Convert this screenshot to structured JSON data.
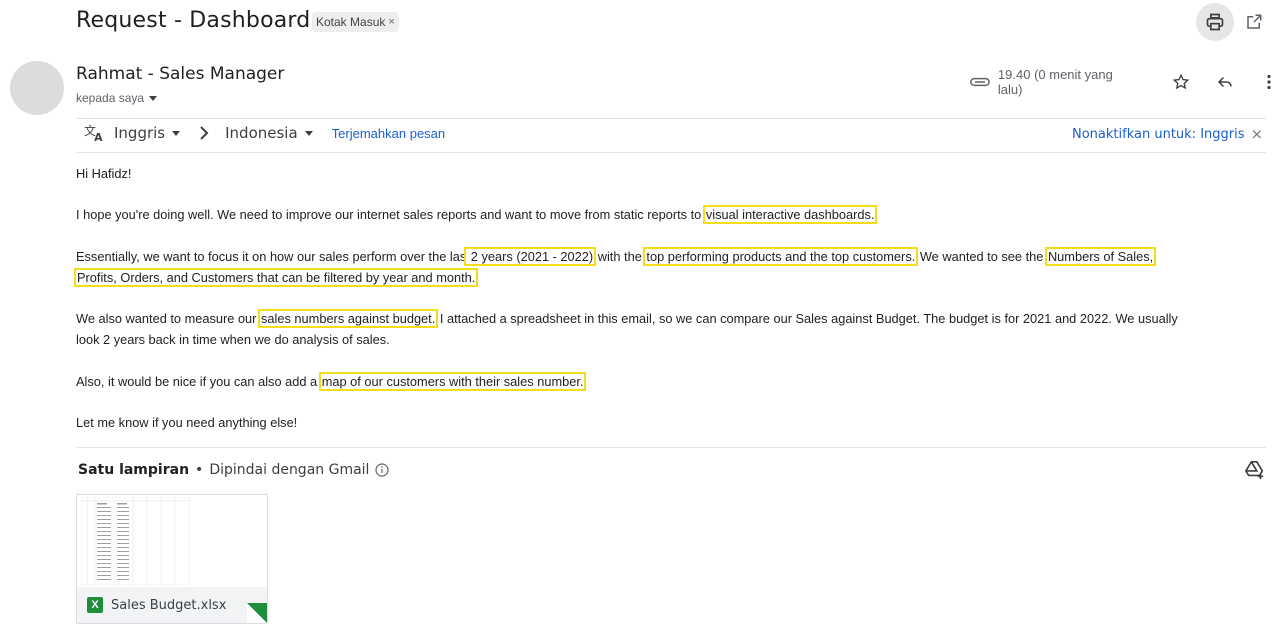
{
  "subject": "Request - Dashboard",
  "label_chip": {
    "text": "Kotak Masuk",
    "remove": "×"
  },
  "sender": {
    "name": "Rahmat - Sales Manager",
    "to": "kepada saya"
  },
  "meta": {
    "time": "19.40 (0 menit yang lalu)"
  },
  "translate_bar": {
    "from": "Inggris",
    "to": "Indonesia",
    "translate_link": "Terjemahkan pesan",
    "disable_text": "Nonaktifkan untuk: Inggris",
    "disable_close": "×"
  },
  "body": {
    "greeting": "Hi Hafidz!",
    "p1_a": "I hope you're doing well. We need to improve our internet sales reports and want to move from static reports to ",
    "p1_hl": "visual interactive dashboards.",
    "p2_a": "Essentially, we want to focus it on how our sales perform over the las",
    "p2_hl1": " 2 years (2021 - 2022)",
    "p2_b": " with the ",
    "p2_hl2": "top performing products and the top customers.",
    "p2_c": " We wanted to see the ",
    "p2_hl3a": "Numbers of Sales,",
    "p2_hl3b": "Profits, Orders, and Customers that can be filtered by year and month.",
    "p3_a": "We also wanted to measure our ",
    "p3_hl": "sales numbers against budget.",
    "p3_b": " I attached a spreadsheet in this email, so we can compare our Sales against Budget. The budget is for 2021 and 2022. We usually",
    "p3_c": "look 2 years back in time when we do analysis of sales.",
    "p4_a": "Also, it would be nice if you can also add a ",
    "p4_hl": "map of our customers with their sales number.",
    "p5": "Let me know if you need anything else!"
  },
  "attachments": {
    "title": "Satu lampiran",
    "dot": "•",
    "scan": "Dipindai dengan Gmail",
    "file": {
      "name": "Sales Budget.xlsx",
      "type_badge": "X"
    }
  },
  "colors": {
    "highlight": "#f3dd1c",
    "link": "#1a5fd1",
    "excel": "#1e8e3e"
  }
}
